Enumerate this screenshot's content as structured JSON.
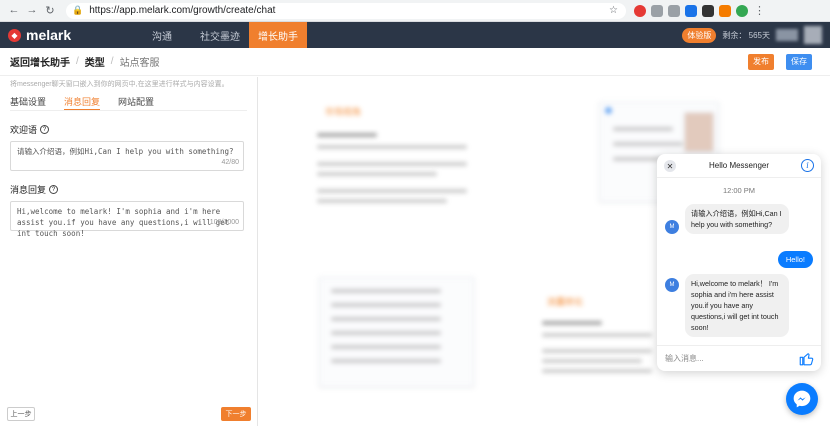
{
  "browser": {
    "url": "https://app.melark.com/growth/create/chat"
  },
  "app": {
    "logo_text": "melark",
    "nav": [
      "沟通",
      "社交墨迹",
      "增长助手"
    ],
    "active_nav": 2,
    "trial_badge": "体验版",
    "remaining": "剩余： 565天"
  },
  "breadcrumb": {
    "back": "返回增长助手",
    "type": "类型",
    "current": "站点客服",
    "publish": "发布",
    "save": "保存"
  },
  "editor": {
    "hint": "将messenger聊天窗口嵌入到你的网页中,在这里进行样式与内容设置。",
    "tabs": [
      "基础设置",
      "消息回复",
      "网站配置"
    ],
    "active_tab": 1,
    "welcome_label": "欢迎语",
    "welcome_placeholder": "请输入介绍语，例如Hi,Can I help you with something?",
    "welcome_counter": "42/80",
    "reply_label": "消息回复",
    "reply_value": "Hi,welcome to melark! I'm sophia and i'm here assist you.if you have any questions,i will get int touch soon!",
    "reply_counter": "108/1000",
    "prev_button": "上一步",
    "next_button": "下一步"
  },
  "preview_bg": {
    "title1": "市场视角",
    "title2": "流量转化"
  },
  "messenger": {
    "title": "Hello Messenger",
    "time": "12:00 PM",
    "avatar_letter": "M",
    "msg1": "请输入介绍语，例如Hi,Can I help you with something?",
    "outgoing": "Hello!",
    "msg2": "Hi,welcome to melark！ I'm sophia and i'm here assist you.if you have any questions,i will get int touch soon!",
    "input_placeholder": "输入消息..."
  },
  "colors": {
    "accent": "#f07f2e",
    "brand_dark": "#2b3647",
    "messenger_blue": "#0a7cff"
  }
}
